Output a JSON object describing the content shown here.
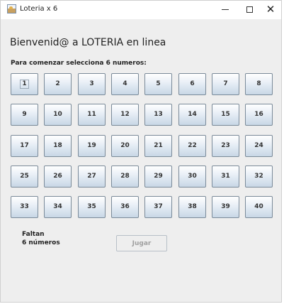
{
  "window": {
    "title": "Loteria x 6",
    "icon": "java-app-icon",
    "controls": {
      "minimize": "minimize-icon",
      "maximize": "maximize-icon",
      "close": "✕"
    }
  },
  "main": {
    "welcome": "Bienvenid@ a LOTERIA en linea",
    "instructions": "Para comenzar selecciona 6 numeros:",
    "numbers": [
      "1",
      "2",
      "3",
      "4",
      "5",
      "6",
      "7",
      "8",
      "9",
      "10",
      "11",
      "12",
      "13",
      "14",
      "15",
      "16",
      "17",
      "18",
      "19",
      "20",
      "21",
      "22",
      "23",
      "24",
      "25",
      "26",
      "27",
      "28",
      "29",
      "30",
      "31",
      "32",
      "33",
      "34",
      "35",
      "36",
      "37",
      "38",
      "39",
      "40"
    ],
    "focused_number": "1",
    "status_line1": "Faltan",
    "status_line2": "6 números",
    "play_label": "Jugar"
  },
  "colors": {
    "window_bg": "#eeeeee",
    "button_border": "#7a8a99",
    "button_gradient_bottom": "#c8d7e6",
    "disabled_text": "#a0a0a0"
  }
}
